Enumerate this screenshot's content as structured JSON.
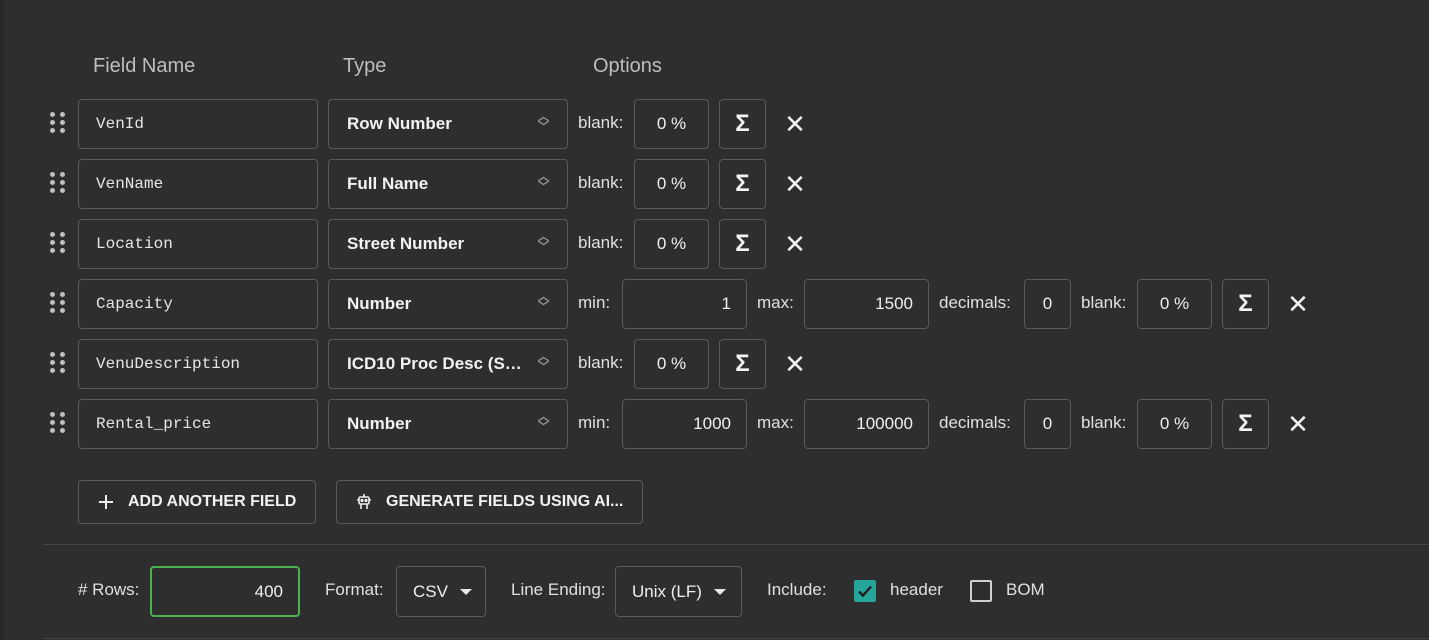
{
  "headers": {
    "field_name": "Field Name",
    "type": "Type",
    "options": "Options"
  },
  "labels": {
    "blank": "blank:",
    "min": "min:",
    "max": "max:",
    "decimals": "decimals:"
  },
  "fields": [
    {
      "name": "VenId",
      "type": "Row Number",
      "blank": "0 %"
    },
    {
      "name": "VenName",
      "type": "Full Name",
      "blank": "0 %"
    },
    {
      "name": "Location",
      "type": "Street Number",
      "blank": "0 %"
    },
    {
      "name": "Capacity",
      "type": "Number",
      "min": "1",
      "max": "1500",
      "decimals": "0",
      "blank": "0 %"
    },
    {
      "name": "VenuDescription",
      "type": "ICD10 Proc Desc (Sh...",
      "blank": "0 %"
    },
    {
      "name": "Rental_price",
      "type": "Number",
      "min": "1000",
      "max": "100000",
      "decimals": "0",
      "blank": "0 %"
    }
  ],
  "actions": {
    "add_field": "ADD ANOTHER FIELD",
    "generate_ai": "GENERATE FIELDS USING AI..."
  },
  "footer": {
    "rows_label": "# Rows:",
    "rows_value": "400",
    "format_label": "Format:",
    "format_value": "CSV",
    "line_ending_label": "Line Ending:",
    "line_ending_value": "Unix (LF)",
    "include_label": "Include:",
    "header_label": "header",
    "header_checked": true,
    "bom_label": "BOM",
    "bom_checked": false
  },
  "colors": {
    "accent": "#26a69a",
    "focus_border": "#4caf50",
    "background": "#2e2e2e"
  }
}
